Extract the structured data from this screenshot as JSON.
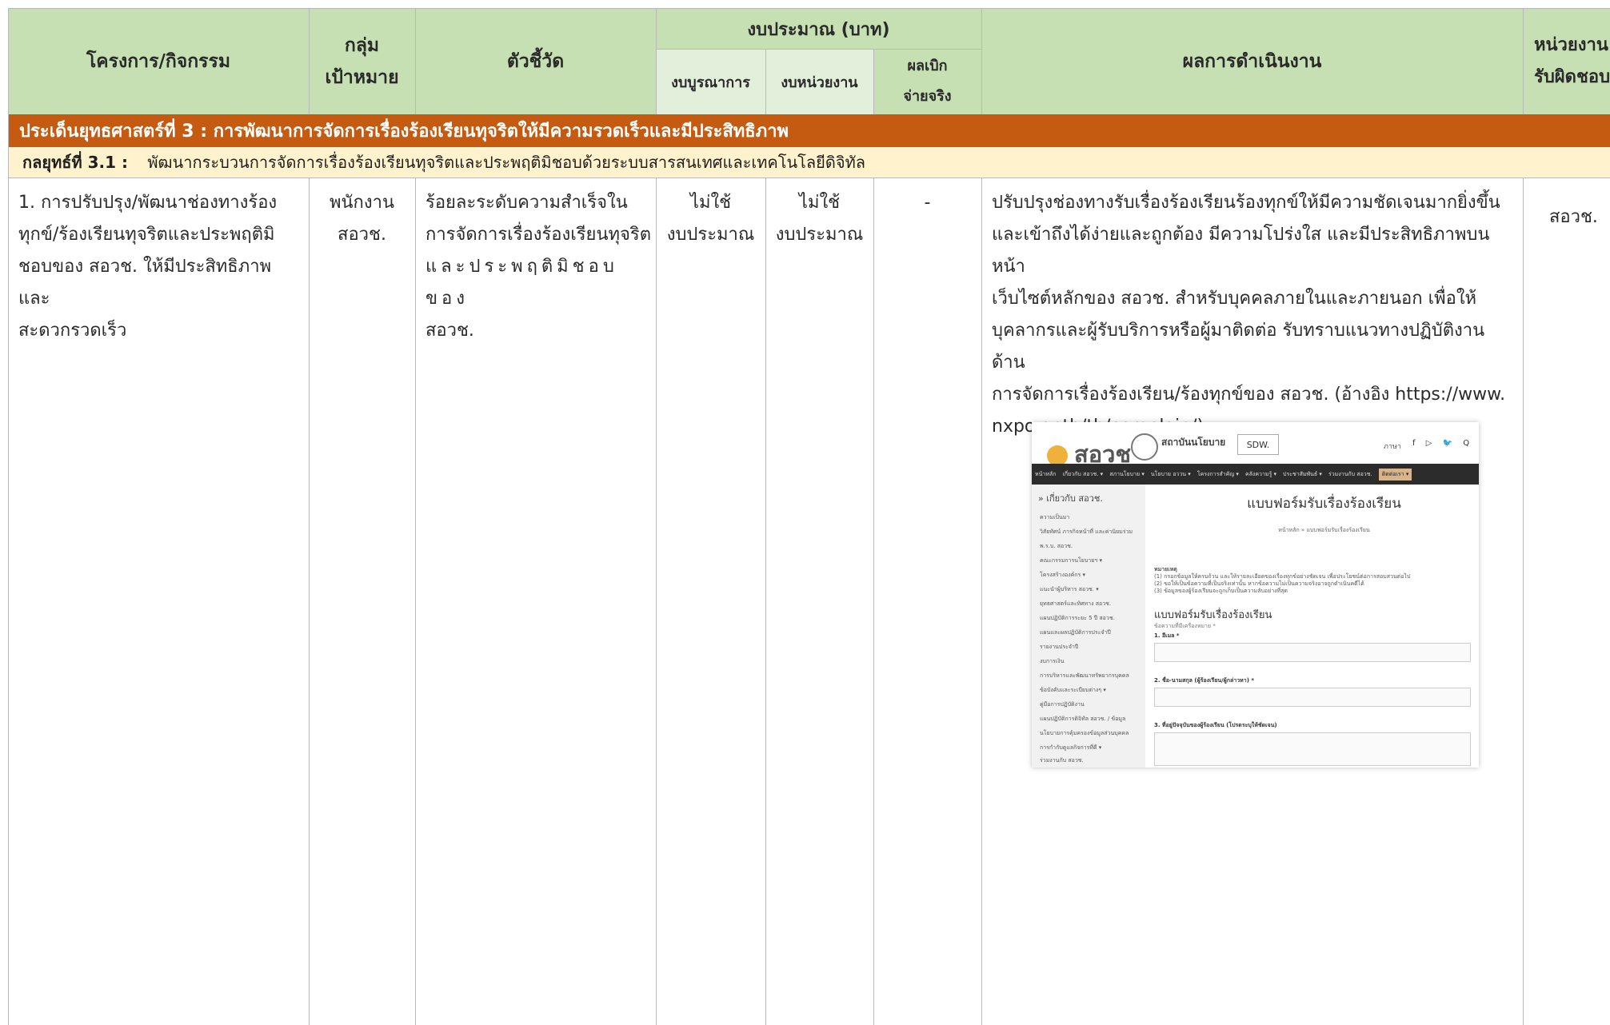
{
  "header": {
    "project": "โครงการ/กิจกรรม",
    "target_line1": "กลุ่ม",
    "target_line2": "เป้าหมาย",
    "indicator": "ตัวชี้วัด",
    "budget_group": "งบประมาณ (บาท)",
    "budget_integrated": "งบบูรณาการ",
    "budget_unit": "งบหน่วยงาน",
    "actual_line1": "ผลเบิก",
    "actual_line2": "จ่ายจริง",
    "results": "ผลการดำเนินงาน",
    "responsible_line1": "หน่วยงาน",
    "responsible_line2": "รับผิดชอบ"
  },
  "strategic_issue": "ประเด็นยุทธศาสตร์ที่ 3 : การพัฒนาการจัดการเรื่องร้องเรียนทุจริตให้มีความรวดเร็วและมีประสิทธิภาพ",
  "strategy": {
    "label": "กลยุทธ์ที่ 3.1 :",
    "text": "พัฒนากระบวนการจัดการเรื่องร้องเรียนทุจริตและประพฤติมิชอบด้วยระบบสารสนเทศและเทคโนโลยีดิจิทัล"
  },
  "row": {
    "project_lines": [
      "1. การปรับปรุง/พัฒนาช่องทางร้อง",
      "ทุกข์/ร้องเรียนทุจริตและประพฤติมิ",
      "ชอบของ สอวช. ให้มีประสิทธิภาพและ",
      "สะดวกรวดเร็ว"
    ],
    "target_lines": [
      "พนักงาน",
      "สอวช."
    ],
    "indicator_lines": [
      "ร้อยละระดับความสำเร็จใน",
      "การจัดการเรื่องร้องเรียนทุจริต",
      "และประพฤติมิชอบของ",
      "สอวช."
    ],
    "budget_integrated_lines": [
      "ไม่ใช้",
      "งบประมาณ"
    ],
    "budget_unit_lines": [
      "ไม่ใช้",
      "งบประมาณ"
    ],
    "actual": "-",
    "results_lines": [
      "ปรับปรุงช่องทางรับเรื่องร้องเรียนร้องทุกข์ให้มีความชัดเจนมากยิ่งขึ้น",
      "และเข้าถึงได้ง่ายและถูกต้อง มีความโปร่งใส และมีประสิทธิภาพบนหน้า",
      "เว็บไซต์หลักของ สอวช. สำหรับบุคคลภายในและภายนอก เพื่อให้",
      "บุคลากรและผู้รับบริการหรือผู้มาติดต่อ รับทราบแนวทางปฏิบัติงานด้าน",
      "การจัดการเรื่องร้องเรียน/ร้องทุกข์ของ สอวช. (อ้างอิง https://www.",
      "nxpo.or.th/th/complain/)"
    ],
    "responsible": "สอวช."
  },
  "embedded_screenshot": {
    "brand": "สอวช",
    "policy_name": "สถาบันนโยบาย",
    "svpill": "SDW.",
    "lang": "ภาษา",
    "social": "f ▷ 🐦 Q",
    "nav_items": [
      "หน้าหลัก",
      "เกี่ยวกับ สอวช. ▾",
      "สภานโยบาย ▾",
      "นโยบาย อววน ▾",
      "โครงการสำคัญ ▾",
      "คลังความรู้ ▾",
      "ประชาสัมพันธ์ ▾",
      "ร่วมงานกับ สอวช."
    ],
    "nav_active": "ติดต่อเรา ▾",
    "side_title": "» เกี่ยวกับ สอวช.",
    "side_items": [
      "ความเป็นมา",
      "วิสัยทัศน์ ภารกิจหน้าที่ และค่านิยมร่วม",
      "พ.ร.บ. สอวช.",
      "คณะกรรมการนโยบายฯ ▾",
      "โครงสร้างองค์กร ▾",
      "แนะนำผู้บริหาร สอวช. ▾",
      "ยุทธศาสตร์และทิศทาง สอวช.",
      "แผนปฏิบัติการระยะ 5 ปี สอวช.",
      "แผนและผลปฏิบัติการประจำปี",
      "รายงานประจำปี",
      "งบการเงิน",
      "การบริหารและพัฒนาทรัพยากรบุคคล",
      "ข้อบังคับและระเบียบต่างๆ ▾",
      "คู่มือการปฏิบัติงาน",
      "แผนปฏิบัติการดิจิทัล สอวช. / ข้อมูล",
      "นโยบายการคุ้มครองข้อมูลส่วนบุคคล",
      "การกำกับดูแลกิจการที่ดี ▾",
      "ร่วมงานกับ สอวช."
    ],
    "form_title": "แบบฟอร์มรับเรื่องร้องเรียน",
    "crumb": "หน้าหลัก » แบบฟอร์มรับเรื่องร้องเรียน",
    "notes": [
      "หมายเหตุ",
      "(1) กรอกข้อมูลให้ครบถ้วน และให้รายละเอียดของเรื่องทุกข์อย่างชัดเจน เพื่อประโยชน์ต่อการสอบสวนต่อไป",
      "(2) ขอให้เป็นข้อความที่เป็นจริงเท่านั้น หากข้อความไม่เป็นความจริงอาจถูกดำเนินคดีได้",
      "(3) ข้อมูลของผู้ร้องเรียนจะถูกเก็บเป็นความลับอย่างที่สุด"
    ],
    "form_h2": "แบบฟอร์มรับเรื่องร้องเรียน",
    "field_note": "ข้อความที่มีเครื่องหมาย *",
    "field1": "1. อีเมล *",
    "field2": "2. ชื่อ-นามสกุล (ผู้ร้องเรียน/ผู้กล่าวหา) *",
    "field3": "3. ที่อยู่ปัจจุบันของผู้ร้องเรียน (โปรดระบุให้ชัดเจน)"
  }
}
